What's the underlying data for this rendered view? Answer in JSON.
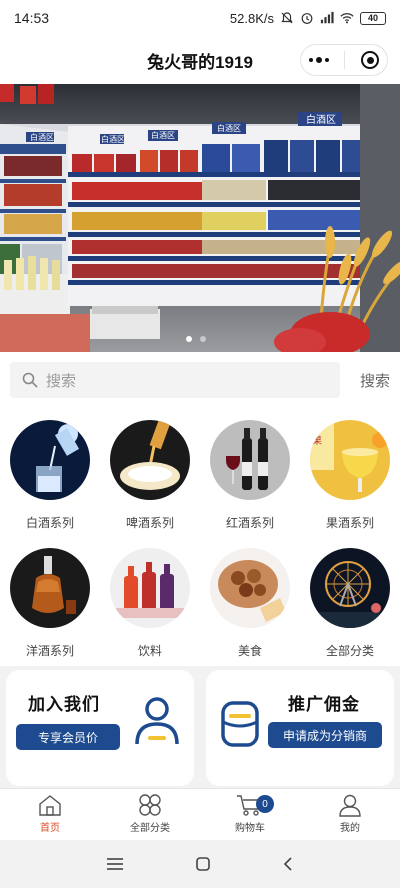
{
  "status": {
    "time": "14:53",
    "speed": "52.8K/s",
    "battery": "40"
  },
  "nav": {
    "title": "兔火哥的1919",
    "more_icon": "more-dots-icon",
    "close_icon": "target-circle-icon"
  },
  "banner": {
    "shelf_labels": [
      "白酒区",
      "白酒区",
      "白酒区",
      "白酒区",
      "白酒区"
    ],
    "slides": 2,
    "active_slide": 1
  },
  "search": {
    "placeholder": "搜索",
    "button": "搜索"
  },
  "categories": [
    {
      "label": "白酒系列",
      "icon": "baijiu-pour-image"
    },
    {
      "label": "啤酒系列",
      "icon": "beer-pour-image"
    },
    {
      "label": "红酒系列",
      "icon": "red-wine-bottles-image"
    },
    {
      "label": "果酒系列",
      "icon": "fruit-wine-image"
    },
    {
      "label": "洋酒系列",
      "icon": "liquor-decanter-image"
    },
    {
      "label": "饮料",
      "icon": "drinks-bottles-image"
    },
    {
      "label": "美食",
      "icon": "food-plate-image"
    },
    {
      "label": "全部分类",
      "icon": "ferris-wheel-image"
    }
  ],
  "promos": {
    "join": {
      "title": "加入我们",
      "button": "专享会员价"
    },
    "commission": {
      "title": "推广佣金",
      "button": "申请成为分销商"
    }
  },
  "tabs": [
    {
      "label": "首页",
      "icon": "home-icon",
      "active": true
    },
    {
      "label": "全部分类",
      "icon": "grid-clover-icon",
      "active": false
    },
    {
      "label": "购物车",
      "icon": "cart-icon",
      "active": false,
      "badge": "0"
    },
    {
      "label": "我的",
      "icon": "user-icon",
      "active": false
    }
  ],
  "colors": {
    "accent": "#1e4b8f",
    "active_tab": "#d9502a",
    "wine_banner_blue": "#3a5bb0"
  }
}
